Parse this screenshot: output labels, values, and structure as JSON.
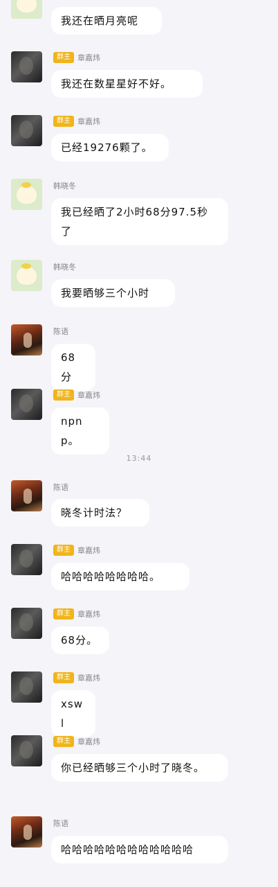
{
  "owner_badge": "群主",
  "timestamp": "13:44",
  "messages": [
    {
      "sender": "",
      "owner": false,
      "avatar": "sheep-avatar",
      "text": "我还在晒月亮呢"
    },
    {
      "sender": "章嘉炜",
      "owner": true,
      "avatar": "dark-portrait-avatar",
      "text": "我还在数星星好不好。"
    },
    {
      "sender": "章嘉炜",
      "owner": true,
      "avatar": "dark-portrait-avatar",
      "text": "已经19276颗了。"
    },
    {
      "sender": "韩晓冬",
      "owner": false,
      "avatar": "sheep-avatar",
      "text": "我已经晒了2小时68分97.5秒了"
    },
    {
      "sender": "韩晓冬",
      "owner": false,
      "avatar": "sheep-avatar",
      "text": "我要晒够三个小时"
    },
    {
      "sender": "陈语",
      "owner": false,
      "avatar": "photo-avatar",
      "text": "68分"
    },
    {
      "sender": "章嘉炜",
      "owner": true,
      "avatar": "dark-portrait-avatar",
      "text": "npnp。"
    },
    {
      "sender": "陈语",
      "owner": false,
      "avatar": "photo-avatar",
      "text": "晓冬计时法？"
    },
    {
      "sender": "章嘉炜",
      "owner": true,
      "avatar": "dark-portrait-avatar",
      "text": "哈哈哈哈哈哈哈哈。"
    },
    {
      "sender": "章嘉炜",
      "owner": true,
      "avatar": "dark-portrait-avatar",
      "text": "68分。"
    },
    {
      "sender": "章嘉炜",
      "owner": true,
      "avatar": "dark-portrait-avatar",
      "text": "xswl"
    },
    {
      "sender": "章嘉炜",
      "owner": true,
      "avatar": "dark-portrait-avatar",
      "text": "你已经晒够三个小时了晓冬。"
    },
    {
      "sender": "陈语",
      "owner": false,
      "avatar": "photo-avatar",
      "text": "哈哈哈哈哈哈哈哈哈哈哈哈"
    }
  ]
}
